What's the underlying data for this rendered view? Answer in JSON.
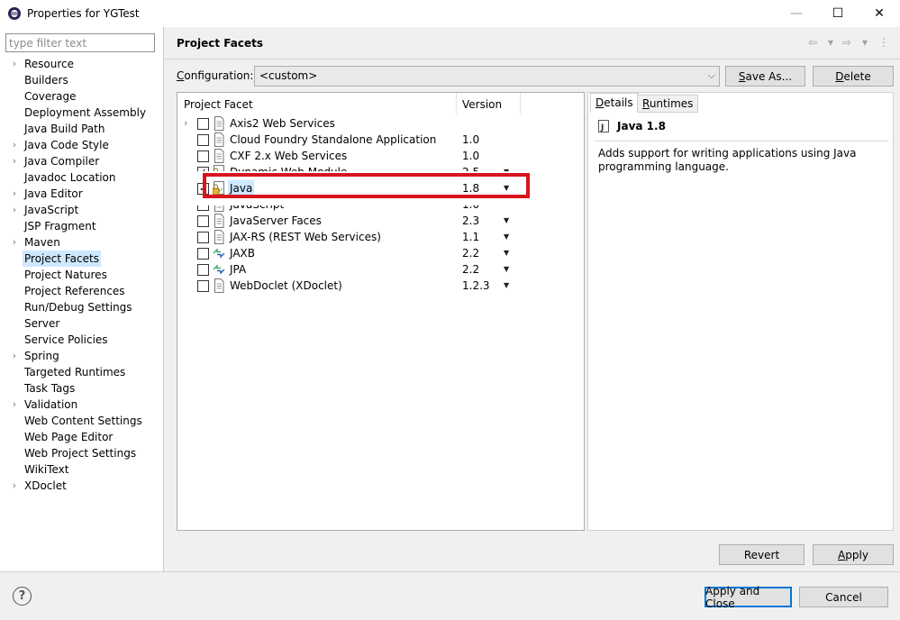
{
  "window": {
    "title": "Properties for YGTest",
    "minimize": "—",
    "maximize": "☐",
    "close": "✕"
  },
  "left": {
    "filter_placeholder": "type filter text",
    "items": [
      {
        "label": "Resource",
        "expandable": true
      },
      {
        "label": "Builders",
        "expandable": false
      },
      {
        "label": "Coverage",
        "expandable": false
      },
      {
        "label": "Deployment Assembly",
        "expandable": false
      },
      {
        "label": "Java Build Path",
        "expandable": false
      },
      {
        "label": "Java Code Style",
        "expandable": true
      },
      {
        "label": "Java Compiler",
        "expandable": true
      },
      {
        "label": "Javadoc Location",
        "expandable": false
      },
      {
        "label": "Java Editor",
        "expandable": true
      },
      {
        "label": "JavaScript",
        "expandable": true
      },
      {
        "label": "JSP Fragment",
        "expandable": false
      },
      {
        "label": "Maven",
        "expandable": true
      },
      {
        "label": "Project Facets",
        "expandable": false,
        "selected": true
      },
      {
        "label": "Project Natures",
        "expandable": false
      },
      {
        "label": "Project References",
        "expandable": false
      },
      {
        "label": "Run/Debug Settings",
        "expandable": false
      },
      {
        "label": "Server",
        "expandable": false
      },
      {
        "label": "Service Policies",
        "expandable": false
      },
      {
        "label": "Spring",
        "expandable": true
      },
      {
        "label": "Targeted Runtimes",
        "expandable": false
      },
      {
        "label": "Task Tags",
        "expandable": false
      },
      {
        "label": "Validation",
        "expandable": true
      },
      {
        "label": "Web Content Settings",
        "expandable": false
      },
      {
        "label": "Web Page Editor",
        "expandable": false
      },
      {
        "label": "Web Project Settings",
        "expandable": false
      },
      {
        "label": "WikiText",
        "expandable": false
      },
      {
        "label": "XDoclet",
        "expandable": true
      }
    ]
  },
  "page": {
    "title": "Project Facets",
    "nav_back": "⇦",
    "nav_forward": "⇨",
    "nav_dd": "▾",
    "nav_menu": "⋮",
    "config_label": "onfiguration:",
    "config_label_key": "C",
    "config_value": "<custom>",
    "save_as": "ave As...",
    "save_as_key": "S",
    "delete": "elete",
    "delete_key": "D"
  },
  "table": {
    "col_facet": "Project Facet",
    "col_version": "Version",
    "rows": [
      {
        "name": "Axis2 Web Services",
        "version": "",
        "checked": false,
        "expander": true,
        "icon": "doc",
        "dropdown": false
      },
      {
        "name": "Cloud Foundry Standalone Application",
        "version": "1.0",
        "checked": false,
        "icon": "doc",
        "dropdown": false
      },
      {
        "name": "CXF 2.x Web Services",
        "version": "1.0",
        "checked": false,
        "icon": "doc",
        "dropdown": false
      },
      {
        "name": "Dynamic Web Module",
        "version": "2.5",
        "checked": true,
        "icon": "lock",
        "dropdown": true,
        "clip": "top"
      },
      {
        "name": "Java",
        "version": "1.8",
        "checked": true,
        "icon": "lock",
        "dropdown": true,
        "selected": true
      },
      {
        "name": "JavaScript",
        "version": "1.0",
        "checked": false,
        "icon": "doc",
        "dropdown": false,
        "clip": "bottom"
      },
      {
        "name": "JavaServer Faces",
        "version": "2.3",
        "checked": false,
        "icon": "doc",
        "dropdown": true
      },
      {
        "name": "JAX-RS (REST Web Services)",
        "version": "1.1",
        "checked": false,
        "icon": "doc",
        "dropdown": true
      },
      {
        "name": "JAXB",
        "version": "2.2",
        "checked": false,
        "icon": "arrows",
        "dropdown": true
      },
      {
        "name": "JPA",
        "version": "2.2",
        "checked": false,
        "icon": "arrows",
        "dropdown": true
      },
      {
        "name": "WebDoclet (XDoclet)",
        "version": "1.2.3",
        "checked": false,
        "icon": "doc",
        "dropdown": true
      }
    ]
  },
  "details": {
    "tab_details_key": "D",
    "tab_details": "etails",
    "tab_runtimes_key": "R",
    "tab_runtimes": "untimes",
    "heading": "Java 1.8",
    "description": "Adds support for writing applications using Java programming language."
  },
  "buttons": {
    "revert": "Revert",
    "apply_key": "A",
    "apply": "pply",
    "apply_close": "Apply and Close",
    "cancel": "Cancel",
    "help": "?"
  },
  "colors": {
    "selection": "#cde8ff",
    "highlight_border": "#d8141e",
    "default_button_border": "#0078d7"
  }
}
